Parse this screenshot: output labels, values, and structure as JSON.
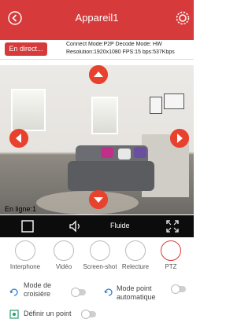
{
  "header": {
    "title": "Appareil1",
    "back_icon": "back-circle-icon",
    "settings_icon": "gear-icon",
    "color": "#d63a3a"
  },
  "info": {
    "live_button": "En direct...",
    "line1": "Connect Mode:P2P  Decode Mode: HW",
    "line2": "Resolution:1920x1080  FPS:15  bps:537Kbps"
  },
  "video": {
    "online_label": "En ligne:1",
    "arrow_color": "#e8412e"
  },
  "video_bar": {
    "quality": "Fluide",
    "record_icon": "square-icon",
    "audio_icon": "speaker-icon",
    "fullscreen_icon": "fullscreen-icon"
  },
  "tools": [
    {
      "label": "Interphone",
      "icon": "intercom-icon"
    },
    {
      "label": "Vidéo",
      "icon": "video-record-icon"
    },
    {
      "label": "Screen-shot",
      "icon": "screenshot-icon"
    },
    {
      "label": "Relecture",
      "icon": "playback-icon"
    },
    {
      "label": "PTZ",
      "icon": "ptz-icon"
    }
  ],
  "options": {
    "cruise": "Mode de croisière",
    "auto_point": "Mode point automatique",
    "define_point": "Définir un point"
  }
}
